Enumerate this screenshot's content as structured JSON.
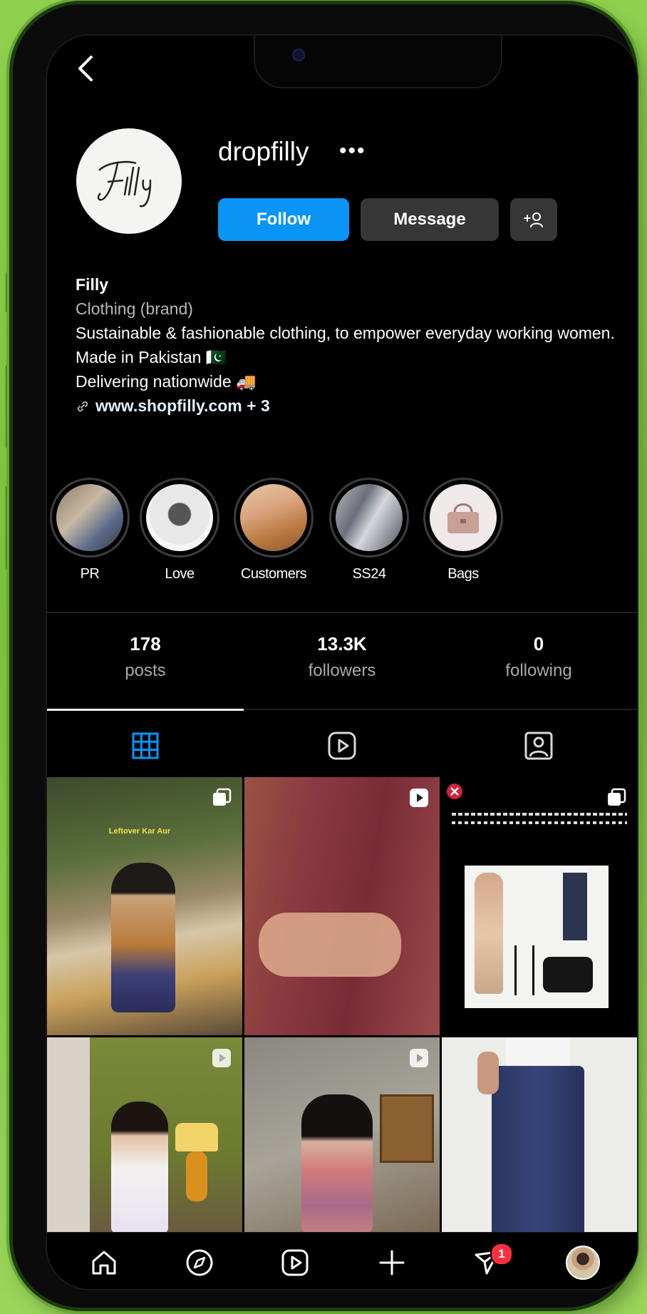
{
  "profile": {
    "username": "dropfilly",
    "more_label": "•••",
    "avatar_text": "Filly"
  },
  "actions": {
    "follow_label": "Follow",
    "message_label": "Message",
    "add_label": "+♀"
  },
  "bio": {
    "name": "Filly",
    "category": "Clothing (brand)",
    "line1": "Sustainable & fashionable clothing, to empower everyday working women.",
    "line2": "Made in Pakistan 🇵🇰",
    "line3": "Delivering nationwide 🚚",
    "link": "www.shopfilly.com + 3"
  },
  "highlights": [
    {
      "label": "PR"
    },
    {
      "label": "Love"
    },
    {
      "label": "Customers"
    },
    {
      "label": "SS24"
    },
    {
      "label": "Bags"
    }
  ],
  "stats": [
    {
      "value": "178",
      "label": "posts"
    },
    {
      "value": "13.3K",
      "label": "followers"
    },
    {
      "value": "0",
      "label": "following"
    }
  ],
  "tabs": [
    {
      "icon": "grid-icon",
      "active": true
    },
    {
      "icon": "reels-icon",
      "active": false
    },
    {
      "icon": "tagged-icon",
      "active": false
    }
  ],
  "posts": [
    {
      "type": "carousel",
      "caption": "Leftover Kar Aur"
    },
    {
      "type": "reel",
      "caption": ""
    },
    {
      "type": "carousel",
      "caption": ""
    },
    {
      "type": "reel",
      "caption": ""
    },
    {
      "type": "reel",
      "caption": ""
    },
    {
      "type": "image",
      "caption": ""
    }
  ],
  "bottom_nav": {
    "items": [
      "home-icon",
      "explore-icon",
      "reels-icon",
      "create-icon",
      "activity-icon",
      "profile-avatar"
    ],
    "notification_count": "1"
  },
  "colors": {
    "accent": "#0a95f6",
    "background": "#000000",
    "phone_frame": "#8fd14f",
    "notification": "#ff2f40"
  }
}
